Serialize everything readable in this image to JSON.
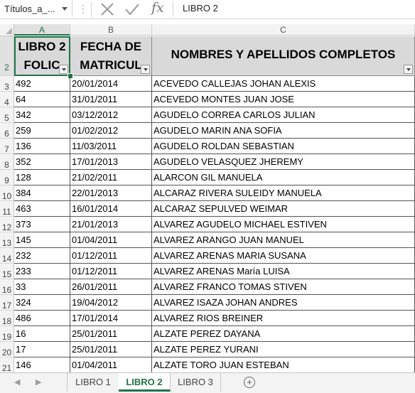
{
  "formula_bar": {
    "name_box": "Títulos_a_...",
    "content": "LIBRO 2"
  },
  "columns": [
    "A",
    "B",
    "C"
  ],
  "header_row": {
    "row_number": "2",
    "col_a": [
      "LIBRO 2",
      "FOLIC"
    ],
    "col_b": [
      "FECHA DE",
      "MATRICUL"
    ],
    "col_c": "NOMBRES Y APELLIDOS COMPLETOS"
  },
  "rows": [
    {
      "n": "3",
      "folio": "492",
      "fecha": "20/01/2014",
      "nombre": "ACEVEDO CALLEJAS JOHAN ALEXIS"
    },
    {
      "n": "4",
      "folio": "64",
      "fecha": "31/01/2011",
      "nombre": "ACEVEDO MONTES JUAN JOSE"
    },
    {
      "n": "5",
      "folio": "342",
      "fecha": "03/12/2012",
      "nombre": "AGUDELO CORREA CARLOS JULIAN"
    },
    {
      "n": "6",
      "folio": "259",
      "fecha": "01/02/2012",
      "nombre": "AGUDELO MARIN ANA SOFIA"
    },
    {
      "n": "7",
      "folio": "136",
      "fecha": "11/03/2011",
      "nombre": "AGUDELO ROLDAN SEBASTIAN"
    },
    {
      "n": "8",
      "folio": "352",
      "fecha": "17/01/2013",
      "nombre": "AGUDELO VELASQUEZ JHEREMY"
    },
    {
      "n": "9",
      "folio": "128",
      "fecha": "21/02/2011",
      "nombre": "ALARCON GIL MANUELA"
    },
    {
      "n": "10",
      "folio": "384",
      "fecha": "22/01/2013",
      "nombre": "ALCARAZ RIVERA SULEIDY MANUELA"
    },
    {
      "n": "11",
      "folio": "463",
      "fecha": "16/01/2014",
      "nombre": "ALCARAZ SEPULVED WEIMAR"
    },
    {
      "n": "12",
      "folio": "373",
      "fecha": "21/01/2013",
      "nombre": "ALVAREZ AGUDELO MICHAEL ESTIVEN"
    },
    {
      "n": "13",
      "folio": "145",
      "fecha": "01/04/2011",
      "nombre": "ALVAREZ ARANGO JUAN MANUEL"
    },
    {
      "n": "14",
      "folio": "232",
      "fecha": "01/12/2011",
      "nombre": "ALVAREZ ARENAS MARIA SUSANA"
    },
    {
      "n": "15",
      "folio": "233",
      "fecha": "01/12/2011",
      "nombre": "ALVAREZ ARENAS María LUISA"
    },
    {
      "n": "16",
      "folio": "33",
      "fecha": "26/01/2011",
      "nombre": "ALVAREZ FRANCO TOMAS STIVEN"
    },
    {
      "n": "17",
      "folio": "324",
      "fecha": "19/04/2012",
      "nombre": "ALVAREZ ISAZA JOHAN ANDRES"
    },
    {
      "n": "18",
      "folio": "486",
      "fecha": "17/01/2014",
      "nombre": "ALVAREZ RIOS BREINER"
    },
    {
      "n": "19",
      "folio": "16",
      "fecha": "25/01/2011",
      "nombre": "ALZATE PEREZ DAYANA"
    },
    {
      "n": "20",
      "folio": "17",
      "fecha": "25/01/2011",
      "nombre": "ALZATE PEREZ YURANI"
    },
    {
      "n": "21",
      "folio": "146",
      "fecha": "01/04/2011",
      "nombre": "ALZATE TORO JUAN ESTEBAN"
    }
  ],
  "sheet_tabs": [
    "LIBRO 1",
    "LIBRO 2",
    "LIBRO 3"
  ],
  "active_tab": "LIBRO 2",
  "colors": {
    "accent": "#217346",
    "header_fill": "#d9d9d9"
  }
}
